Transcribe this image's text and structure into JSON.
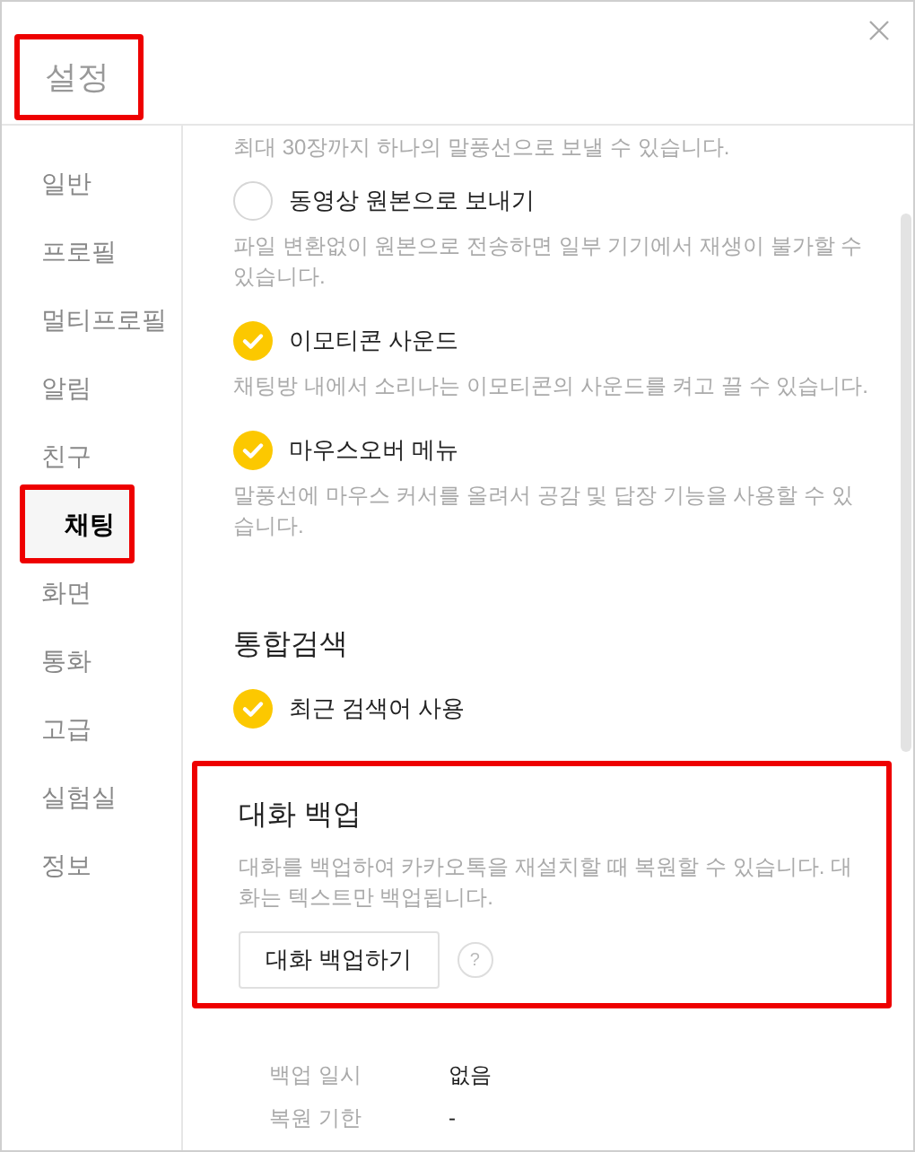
{
  "window": {
    "title": "설정",
    "title_highlighted": true
  },
  "sidebar": {
    "items": [
      {
        "label": "일반",
        "selected": false,
        "highlighted": false
      },
      {
        "label": "프로필",
        "selected": false,
        "highlighted": false
      },
      {
        "label": "멀티프로필",
        "selected": false,
        "highlighted": false
      },
      {
        "label": "알림",
        "selected": false,
        "highlighted": false
      },
      {
        "label": "친구",
        "selected": false,
        "highlighted": false
      },
      {
        "label": "채팅",
        "selected": true,
        "highlighted": true
      },
      {
        "label": "화면",
        "selected": false,
        "highlighted": false
      },
      {
        "label": "통화",
        "selected": false,
        "highlighted": false
      },
      {
        "label": "고급",
        "selected": false,
        "highlighted": false
      },
      {
        "label": "실험실",
        "selected": false,
        "highlighted": false
      },
      {
        "label": "정보",
        "selected": false,
        "highlighted": false
      }
    ]
  },
  "content": [
    {
      "kind": "note",
      "text": "최대 30장까지 하나의 말풍선으로 보낼 수 있습니다."
    },
    {
      "kind": "option",
      "label": "동영상 원본으로 보내기",
      "checked": false,
      "description": "파일 변환없이 원본으로 전송하면 일부 기기에서 재생이 불가할 수 있습니다."
    },
    {
      "kind": "option",
      "label": "이모티콘 사운드",
      "checked": true,
      "description": "채팅방 내에서 소리나는 이모티콘의 사운드를 켜고 끌 수 있습니다."
    },
    {
      "kind": "option",
      "label": "마우스오버 메뉴",
      "checked": true,
      "description": "말풍선에 마우스 커서를 올려서 공감 및 답장 기능을 사용할 수 있습니다."
    },
    {
      "kind": "heading",
      "text": "통합검색"
    },
    {
      "kind": "option",
      "label": "최근 검색어 사용",
      "checked": true
    }
  ],
  "backup": {
    "title": "대화 백업",
    "highlighted": true,
    "description": "대화를 백업하여 카카오톡을 재설치할 때 복원할 수 있습니다. 대화는 텍스트만 백업됩니다.",
    "button": "대화 백업하기",
    "help": "?",
    "details": [
      {
        "label": "백업 일시",
        "value": "없음"
      },
      {
        "label": "복원 기한",
        "value": "-"
      }
    ]
  }
}
